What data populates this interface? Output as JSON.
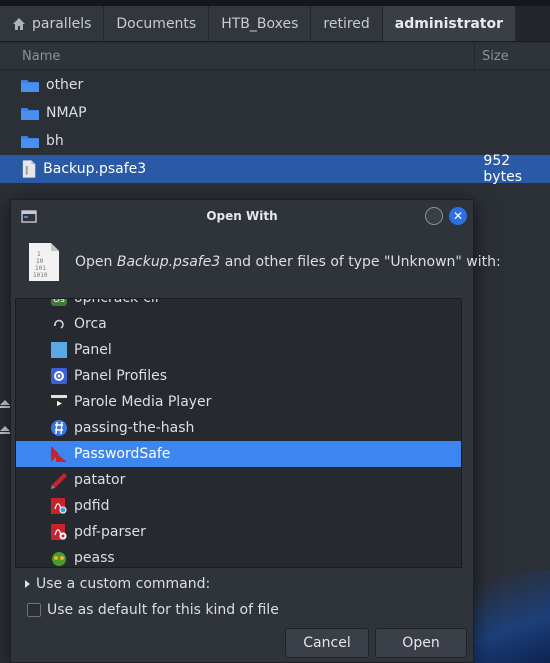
{
  "breadcrumb": [
    "parallels",
    "Documents",
    "HTB_Boxes",
    "retired",
    "administrator"
  ],
  "file_list": {
    "columns": {
      "name": "Name",
      "size": "Size"
    },
    "rows": [
      {
        "name": "other",
        "size": "",
        "type": "folder"
      },
      {
        "name": "NMAP",
        "size": "",
        "type": "folder"
      },
      {
        "name": "bh",
        "size": "",
        "type": "folder"
      },
      {
        "name": "Backup.psafe3",
        "size": "952 bytes",
        "type": "file",
        "selected": true
      }
    ]
  },
  "dialog": {
    "title": "Open With",
    "prompt_prefix": "Open ",
    "prompt_file": "Backup.psafe3",
    "prompt_suffix": " and other files of type \"Unknown\" with:",
    "doc_icon_lines": [
      "1",
      "10",
      "101",
      "1010"
    ],
    "apps": [
      {
        "name": "ophcrack-cli",
        "icon": "ophcrack-icon"
      },
      {
        "name": "Orca",
        "icon": "orca-icon"
      },
      {
        "name": "Panel",
        "icon": "panel-icon"
      },
      {
        "name": "Panel Profiles",
        "icon": "panel-profiles-icon"
      },
      {
        "name": "Parole Media Player",
        "icon": "parole-icon"
      },
      {
        "name": "passing-the-hash",
        "icon": "passing-the-hash-icon"
      },
      {
        "name": "PasswordSafe",
        "icon": "passwordsafe-icon",
        "selected": true
      },
      {
        "name": "patator",
        "icon": "patator-icon"
      },
      {
        "name": "pdfid",
        "icon": "pdfid-icon"
      },
      {
        "name": "pdf-parser",
        "icon": "pdf-parser-icon"
      },
      {
        "name": "peass",
        "icon": "peass-icon"
      }
    ],
    "custom_command_label": "Use a custom command:",
    "default_label": "Use as default for this kind of file",
    "cancel_label": "Cancel",
    "open_label": "Open"
  },
  "colors": {
    "selection": "#2a5aa6",
    "list_selection": "#3d86f0",
    "close_button": "#2d6fe0",
    "folder": "#3b82e8"
  }
}
